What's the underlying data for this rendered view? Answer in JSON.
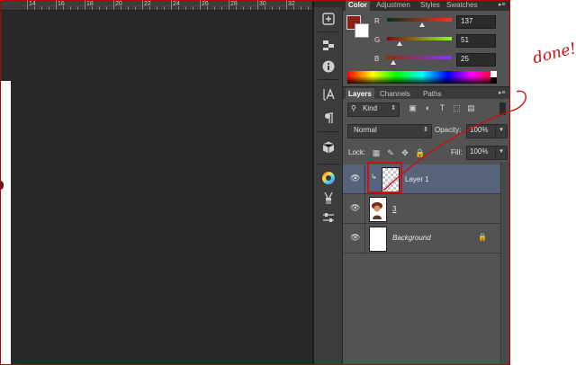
{
  "ruler": {
    "labels": [
      "14",
      "16",
      "18",
      "20",
      "22",
      "24",
      "26",
      "28",
      "30",
      "32"
    ]
  },
  "color_panel": {
    "tabs": [
      "Color",
      "Adjustmen",
      "Styles",
      "Swatches"
    ],
    "foreground_color": "#892119",
    "background_color": "#ffffff",
    "channels": [
      {
        "label": "R",
        "value": "137",
        "level": 0.537
      },
      {
        "label": "G",
        "value": "51",
        "level": 0.2
      },
      {
        "label": "B",
        "value": "25",
        "level": 0.098
      }
    ]
  },
  "layers_panel": {
    "tabs": [
      "Layers",
      "Channels",
      "Paths"
    ],
    "filter_kind": "Kind",
    "blend_mode": "Normal",
    "opacity_label": "Opacity:",
    "opacity_value": "100%",
    "lock_label": "Lock:",
    "fill_label": "Fill:",
    "fill_value": "100%",
    "layers": [
      {
        "name": "Layer 1",
        "selected": true,
        "thumb": "transparent"
      },
      {
        "name": "3",
        "selected": false,
        "thumb": "portrait"
      },
      {
        "name": "Background",
        "selected": false,
        "thumb": "white",
        "locked": true
      }
    ]
  },
  "annotation": {
    "text": "done!",
    "color": "#cc1010"
  },
  "tools": [
    "history-icon",
    "info-icon",
    "character-icon",
    "paragraph-icon",
    "3d-icon",
    "color-wheel-icon",
    "brush-preset-icon",
    "adjust-icon"
  ]
}
